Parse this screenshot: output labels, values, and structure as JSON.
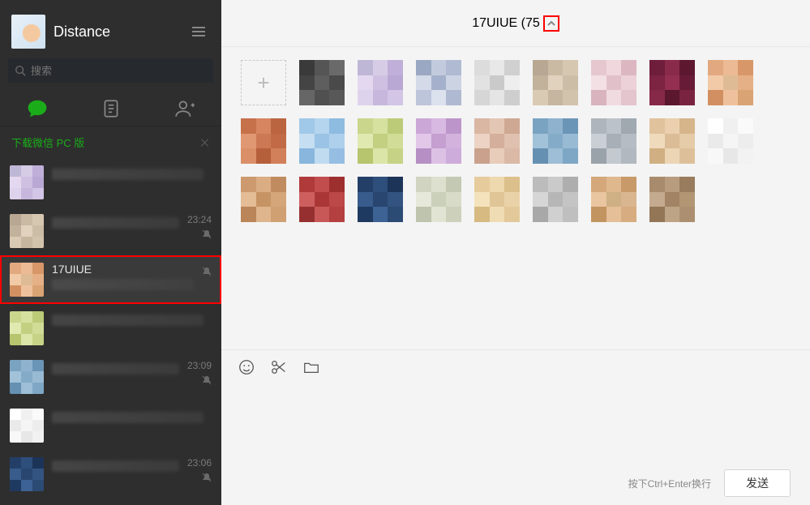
{
  "profile": {
    "name": "Distance"
  },
  "search": {
    "placeholder": "搜索"
  },
  "banner": {
    "text": "下载微信 PC 版"
  },
  "chats": [
    {
      "title": "",
      "time": "",
      "muted": false
    },
    {
      "title": "",
      "time": "23:24",
      "muted": true
    },
    {
      "title": "17UIUE",
      "time": "",
      "muted": true,
      "selected": true
    },
    {
      "title": "",
      "time": "",
      "muted": false
    },
    {
      "title": "",
      "time": "23:09",
      "muted": true
    },
    {
      "title": "",
      "time": "",
      "muted": false
    },
    {
      "title": "",
      "time": "23:06",
      "muted": true
    }
  ],
  "header": {
    "title": "17UIUE (75"
  },
  "memberCount": 25,
  "compose": {
    "hint": "按下Ctrl+Enter换行",
    "send": "发送"
  },
  "avatarPalettes": [
    [
      "#3a3a3a",
      "#555",
      "#6a6a6a",
      "#444",
      "#5e5e5e",
      "#4a4a4a",
      "#666",
      "#505050",
      "#585858"
    ],
    [
      "#bfb7d6",
      "#d6cce6",
      "#c0afd9",
      "#e3d8ef",
      "#cfc0e2",
      "#b9a7d4",
      "#ded3ec",
      "#c7b7dd",
      "#d2c5e5"
    ],
    [
      "#9aa8c3",
      "#c2cbdd",
      "#b0bad2",
      "#d4dae8",
      "#a5b1cc",
      "#ccd4e3",
      "#bcc5da",
      "#dbe1ed",
      "#afb9d1"
    ],
    [
      "#dcdcdc",
      "#e8e8e8",
      "#d0d0d0",
      "#e2e2e2",
      "#cacaca",
      "#eeeeee",
      "#d6d6d6",
      "#e5e5e5",
      "#cecece"
    ],
    [
      "#b8a893",
      "#cabaa4",
      "#d6c7b1",
      "#c2b29c",
      "#e0d2bc",
      "#ccbda7",
      "#d9cab4",
      "#c6b6a0",
      "#d2c3ad"
    ],
    [
      "#e6c7cf",
      "#efd7dd",
      "#dcb7c1",
      "#f3e0e5",
      "#e2c0ca",
      "#ecd1d8",
      "#d9b3be",
      "#f0dbe1",
      "#e4c4cd"
    ],
    [
      "#6e1d3a",
      "#8a2a4a",
      "#5d1830",
      "#7c2442",
      "#942f52",
      "#681b36",
      "#862848",
      "#5a172e",
      "#7a2340"
    ],
    [
      "#e2a87f",
      "#ecba94",
      "#d89769",
      "#f2caa7",
      "#debb95",
      "#e6b086",
      "#d29062",
      "#eec19c",
      "#daa374"
    ],
    [
      "#c7714b",
      "#d68560",
      "#bb6440",
      "#e09873",
      "#cc7854",
      "#c16a45",
      "#db8f69",
      "#b65f3b",
      "#d2805a"
    ],
    [
      "#a0c8e8",
      "#b5d5ee",
      "#8ebbe0",
      "#c5def1",
      "#9bc3e5",
      "#aed0ec",
      "#88b6dd",
      "#c0dbf0",
      "#95bee2"
    ],
    [
      "#c9d68c",
      "#d6e1a0",
      "#bccb78",
      "#e0e9b0",
      "#c3d082",
      "#d1dc96",
      "#b6c56e",
      "#dbe5a8",
      "#c6d386"
    ],
    [
      "#caa7d6",
      "#d8b9e1",
      "#bc96ca",
      "#e2c7e9",
      "#c49fd0",
      "#d3b2dd",
      "#b690c5",
      "#ddc1e5",
      "#cdabda"
    ],
    [
      "#d9b7a3",
      "#e4c6b4",
      "#cea893",
      "#ecd3c3",
      "#d4b09c",
      "#e0c0ae",
      "#c9a18c",
      "#e8cdbb",
      "#dab9a6"
    ],
    [
      "#7aa3c2",
      "#8fb3cf",
      "#6b95b6",
      "#a2c2d9",
      "#84acc9",
      "#98bad3",
      "#6590b2",
      "#9dbed6",
      "#7ea7c5"
    ],
    [
      "#aeb5bc",
      "#bcc2c9",
      "#a0a8b0",
      "#c9cfd5",
      "#a8afb6",
      "#b6bcc3",
      "#9aa2aa",
      "#c3c9cf",
      "#b1b8bf"
    ],
    [
      "#e0c29c",
      "#ead0ae",
      "#d6b58b",
      "#f0dabc",
      "#dabc96",
      "#e5cba8",
      "#d0af82",
      "#ecd5b4",
      "#ddc09a"
    ],
    [
      "#ffffff",
      "#f0f0f0",
      "#fafafa",
      "#eaeaea",
      "#f5f5f5",
      "#ededed",
      "#f8f8f8",
      "#e7e7e7",
      "#f2f2f2"
    ],
    [
      "#cc9a6e",
      "#daad83",
      "#c08c5f",
      "#e4bc96",
      "#c69364",
      "#d4a679",
      "#ba8558",
      "#dfb58d",
      "#d0a072"
    ],
    [
      "#b03a3a",
      "#c24d4d",
      "#9e2f2f",
      "#ce5f5f",
      "#aa3636",
      "#bc4848",
      "#963030",
      "#c85858",
      "#b44040"
    ],
    [
      "#233f68",
      "#2e4e7c",
      "#1c3458",
      "#385c8c",
      "#28466f",
      "#335480",
      "#1f3a60",
      "#3d6294",
      "#2b4a74"
    ],
    [
      "#d0d4c0",
      "#dde0ce",
      "#c4c9b3",
      "#e6e9d9",
      "#cad0ba",
      "#d7dbc8",
      "#bec4ad",
      "#e1e4d3",
      "#cdd1bc"
    ],
    [
      "#e6cc9c",
      "#eed8ae",
      "#dcc08b",
      "#f4e2bc",
      "#e0c596",
      "#ead2a8",
      "#d6ba82",
      "#f0dcb4",
      "#e3c99a"
    ],
    [
      "#bcbcbc",
      "#cacaca",
      "#aeaeae",
      "#d6d6d6",
      "#b6b6b6",
      "#c4c4c4",
      "#a8a8a8",
      "#d0d0d0",
      "#bfbfbf"
    ],
    [
      "#d4a87a",
      "#e0b88e",
      "#c89a6a",
      "#e9c5a0",
      "#ceb084",
      "#dab690",
      "#c29460",
      "#e4bf98",
      "#d6ac80"
    ],
    [
      "#a88b6c",
      "#b89c7e",
      "#997c5e",
      "#c4aa8e",
      "#a28464",
      "#b29674",
      "#937656",
      "#bea486",
      "#ac8f70"
    ]
  ]
}
